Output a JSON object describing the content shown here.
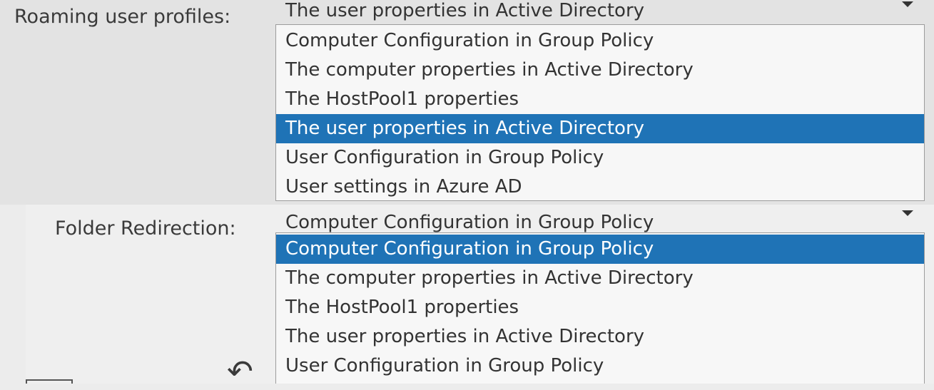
{
  "roaming": {
    "label": "Roaming user profiles:",
    "selected": "The user properties in Active Directory",
    "options": [
      "Computer Configuration in Group Policy",
      "The computer properties in Active Directory",
      "The HostPool1 properties",
      "The user properties in Active Directory",
      "User Configuration in Group Policy",
      "User settings in Azure AD"
    ],
    "highlighted_index": 3
  },
  "folder": {
    "label": "Folder Redirection:",
    "selected": "Computer Configuration in Group Policy",
    "options": [
      "Computer Configuration in Group Policy",
      "The computer properties in Active Directory",
      "The HostPool1 properties",
      "The user properties in Active Directory",
      "User Configuration in Group Policy"
    ],
    "highlighted_index": 0
  },
  "icons": {
    "dropdown": "chevron-down-icon",
    "back": "undo-arrow-icon"
  },
  "colors": {
    "highlight": "#1f73b6",
    "highlight_text": "#ffffff"
  }
}
